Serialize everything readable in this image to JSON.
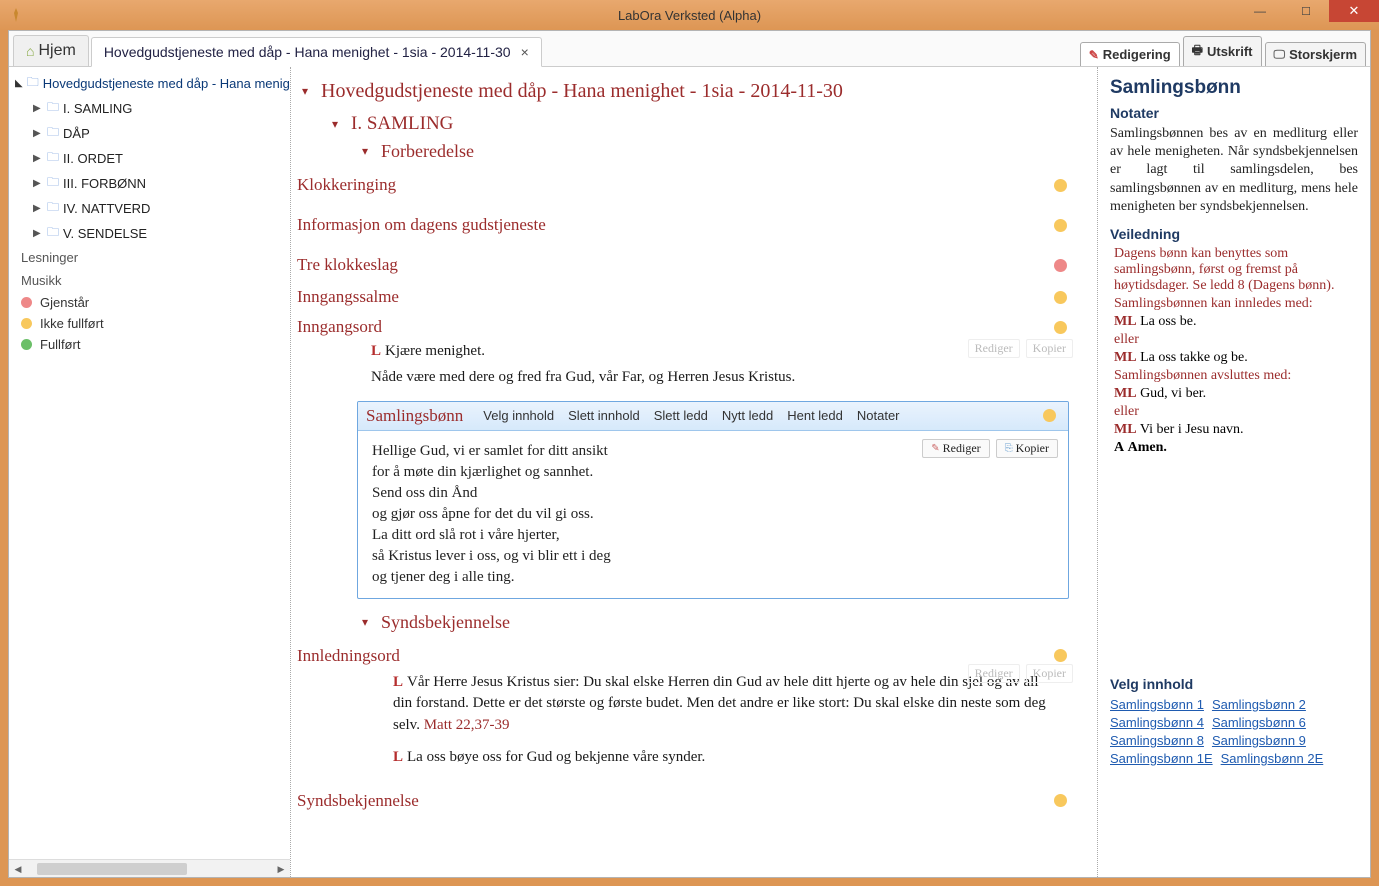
{
  "window": {
    "title": "LabOra Verksted (Alpha)"
  },
  "tabs": {
    "home": "Hjem",
    "doc": "Hovedgudstjeneste med dåp - Hana menighet - 1sia - 2014-11-30",
    "right": {
      "edit": "Redigering",
      "print": "Utskrift",
      "bigscreen": "Storskjerm"
    }
  },
  "sidebar": {
    "root": "Hovedgudstjeneste med dåp - Hana menighet",
    "items": [
      "I. SAMLING",
      "DÅP",
      "II. ORDET",
      "III. FORBØNN",
      "IV. NATTVERD",
      "V. SENDELSE"
    ],
    "lesninger": "Lesninger",
    "musikk": "Musikk",
    "legend": {
      "remain": "Gjenstår",
      "incomplete": "Ikke fullført",
      "done": "Fullført"
    }
  },
  "doc": {
    "title": "Hovedgudstjeneste med dåp - Hana menighet - 1sia - 2014-11-30",
    "s1": "I. SAMLING",
    "prep": "Forberedelse",
    "items": {
      "klokke": "Klokkeringing",
      "info": "Informasjon om dagens gudstjeneste",
      "treklokke": "Tre klokkeslag",
      "inngangs": "Inngangssalme",
      "inngangsord": "Inngangsord"
    },
    "inngangsord_body": {
      "l_prefix": "L",
      "line1": "Kjære menighet.",
      "line2": "Nåde være med dere og fred fra Gud, vår Far, og Herren Jesus Kristus."
    },
    "faint": {
      "rediger": "Rediger",
      "kopier": "Kopier"
    },
    "sel": {
      "title": "Samlingsbønn",
      "acts": [
        "Velg innhold",
        "Slett innhold",
        "Slett ledd",
        "Nytt ledd",
        "Hent ledd",
        "Notater"
      ],
      "edit_btn": "Rediger",
      "copy_btn": "Kopier",
      "lines": [
        "Hellige Gud, vi er samlet for ditt ansikt",
        "for å møte din kjærlighet og sannhet.",
        "Send oss din Ånd",
        "og gjør oss åpne for det du vil gi oss.",
        "La ditt ord slå rot i våre hjerter,",
        "så Kristus lever i oss, og vi blir ett i deg",
        "og tjener deg i alle ting."
      ]
    },
    "synds": {
      "title": "Syndsbekjennelse",
      "innled": "Innledningsord",
      "l_prefix": "L",
      "body1": "Vår Herre Jesus Kristus sier: Du skal elske Herren din Gud av hele ditt hjerte og av hele din sjel og av all din forstand. Dette er det største og første budet. Men det andre er like stort: Du skal elske din neste som deg selv. ",
      "ref": "Matt 22,37-39",
      "body2": "La oss bøye oss for Gud og bekjenne våre synder.",
      "sub": "Syndsbekjennelse"
    }
  },
  "right": {
    "title": "Samlingsbønn",
    "notater": "Notater",
    "notater_body": "Samlingsbønnen bes av en medliturg eller av hele menigheten.  Når syndsbekjennelsen er lagt til samlingsdelen, bes samlingsbønnen av en medliturg, mens hele menigheten ber syndsbekjennelsen.",
    "veiledning": "Veiledning",
    "g1": "Dagens bønn kan benyttes som samlingsbønn, først og fremst på høytidsdager. Se ledd 8 (Dagens bønn).",
    "g2": "Samlingsbønnen kan innledes med:",
    "ml": "ML",
    "g3": "La oss be.",
    "eller": "eller",
    "g4": "La oss takke og be.",
    "g5": "Samlingsbønnen avsluttes med:",
    "g6": "Gud, vi ber.",
    "g7": "Vi ber i Jesu navn.",
    "a": "A",
    "amen": "Amen.",
    "velg": "Velg innhold",
    "links": [
      [
        "Samlingsbønn 1",
        "Samlingsbønn 2"
      ],
      [
        "Samlingsbønn 4",
        "Samlingsbønn 6"
      ],
      [
        "Samlingsbønn 8",
        "Samlingsbønn 9"
      ],
      [
        "Samlingsbønn 1E",
        "Samlingsbønn 2E"
      ]
    ]
  }
}
